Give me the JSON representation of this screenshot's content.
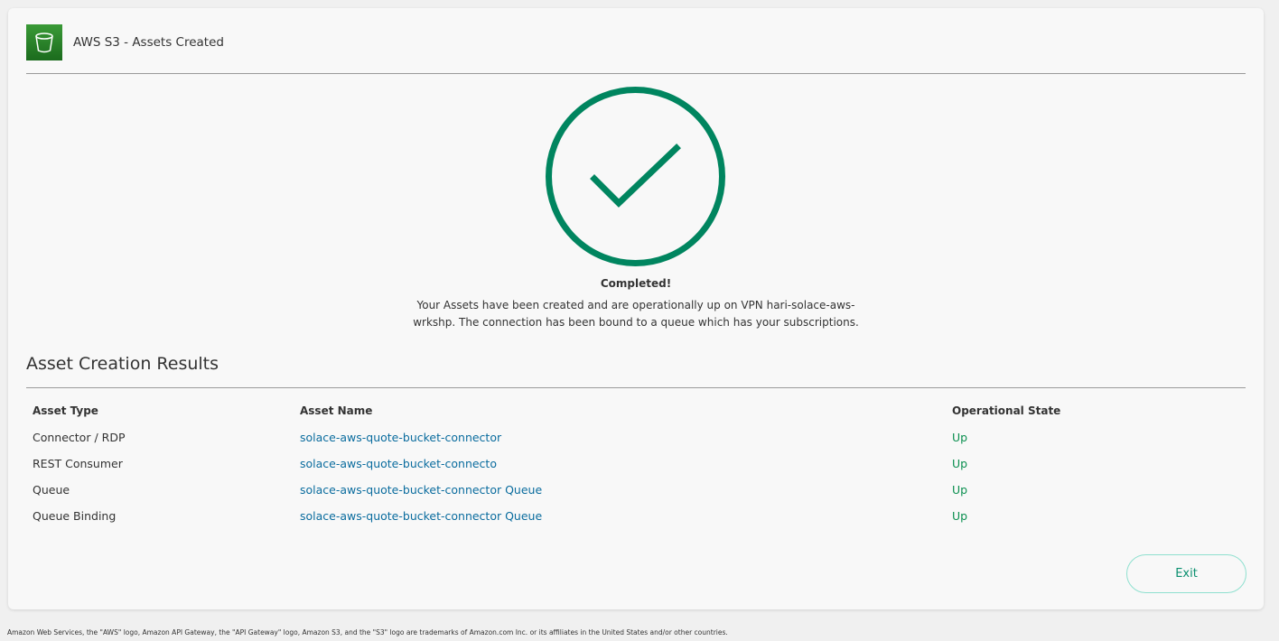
{
  "header": {
    "title": "AWS S3 - Assets Created",
    "logo_icon": "s3-bucket-icon"
  },
  "status": {
    "icon": "check-circle-icon",
    "heading": "Completed!",
    "message": "Your Assets have been created and are operationally up on VPN hari-solace-aws-wrkshp. The connection has been bound to a queue which has your subscriptions."
  },
  "results": {
    "title": "Asset Creation Results",
    "columns": [
      "Asset Type",
      "Asset Name",
      "Operational State"
    ],
    "rows": [
      {
        "type": "Connector / RDP",
        "name": "solace-aws-quote-bucket-connector",
        "state": "Up"
      },
      {
        "type": "REST Consumer",
        "name": "solace-aws-quote-bucket-connecto",
        "state": "Up"
      },
      {
        "type": "Queue",
        "name": "solace-aws-quote-bucket-connector Queue",
        "state": "Up"
      },
      {
        "type": "Queue Binding",
        "name": "solace-aws-quote-bucket-connector Queue",
        "state": "Up"
      }
    ]
  },
  "actions": {
    "exit_label": "Exit"
  },
  "footer": {
    "text": "Amazon Web Services, the \"AWS\" logo, Amazon API Gateway, the \"API Gateway\" logo, Amazon S3, and the \"S3\" logo are trademarks of Amazon.com Inc. or its affiliates in the United States and/or other countries."
  },
  "colors": {
    "accent": "#00855f",
    "link": "#0a6c9e",
    "state_up": "#0a8f4f",
    "exit_border": "#8fe0cf"
  }
}
